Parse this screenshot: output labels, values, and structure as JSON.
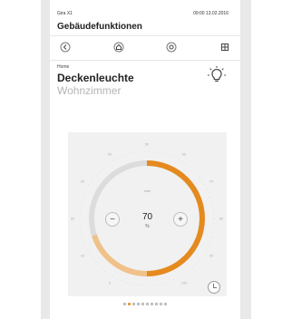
{
  "status": {
    "left": "Gira X1",
    "right": "09:00 13.02.2016"
  },
  "header": {
    "title": "Gebäudefunktionen"
  },
  "nav": {
    "icons": [
      "back-icon",
      "home-icon",
      "gear-icon",
      "grid-icon"
    ]
  },
  "device": {
    "location": "Home",
    "name": "Deckenleuchte",
    "room": "Wohnzimmer"
  },
  "dial": {
    "top_label": "min",
    "value": "70",
    "unit": "%",
    "scale_labels": [
      "0",
      "10",
      "20",
      "30",
      "40",
      "50",
      "60",
      "70",
      "80",
      "90",
      "100"
    ],
    "accent_color": "#e58a1f",
    "accent_light": "#f0c189",
    "level_percent": 70
  },
  "pager": {
    "count": 10,
    "active_index": 1
  }
}
